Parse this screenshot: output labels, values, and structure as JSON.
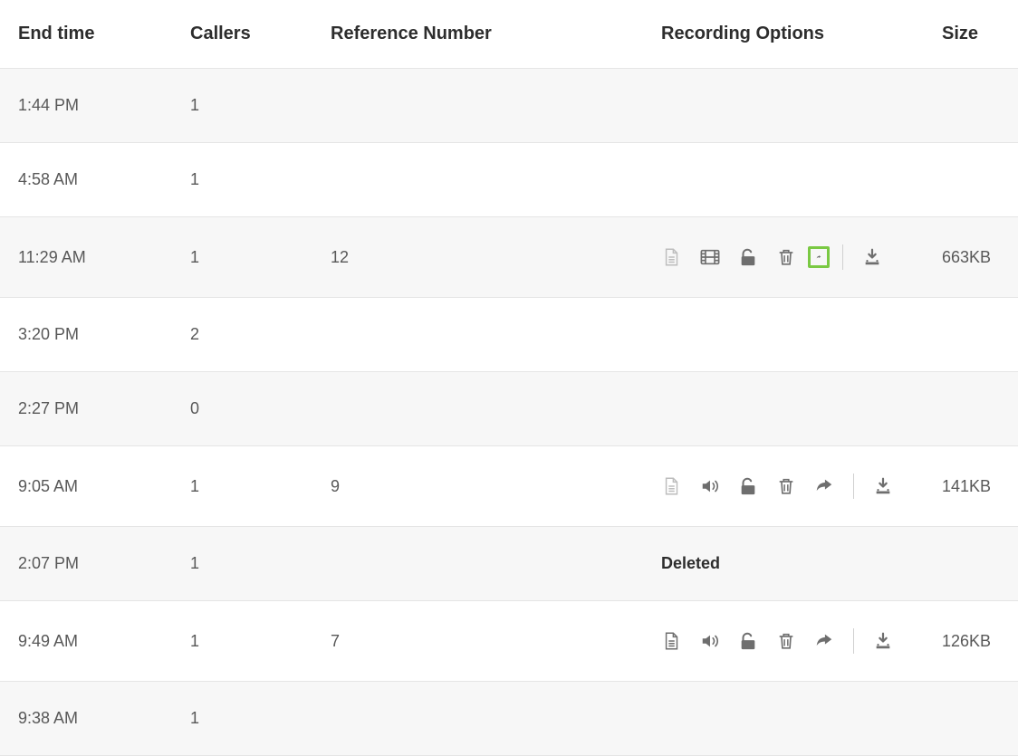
{
  "columns": {
    "end_time": "End time",
    "callers": "Callers",
    "reference": "Reference Number",
    "recording_options": "Recording Options",
    "size": "Size"
  },
  "labels": {
    "deleted": "Deleted"
  },
  "icon_colors": {
    "default": "#6e6e6e",
    "faded": "#bdbdbd",
    "highlight_border": "#7ac943"
  },
  "rows": [
    {
      "end_time": "1:44 PM",
      "callers": "1",
      "reference": "",
      "options": null,
      "size": ""
    },
    {
      "end_time": "4:58 AM",
      "callers": "1",
      "reference": "",
      "options": null,
      "size": ""
    },
    {
      "end_time": "11:29 AM",
      "callers": "1",
      "reference": "12",
      "options": {
        "type": "icons",
        "doc_faded": true,
        "second": "film",
        "highlight_share": true
      },
      "size": "663KB"
    },
    {
      "end_time": "3:20 PM",
      "callers": "2",
      "reference": "",
      "options": null,
      "size": ""
    },
    {
      "end_time": "2:27 PM",
      "callers": "0",
      "reference": "",
      "options": null,
      "size": ""
    },
    {
      "end_time": "9:05 AM",
      "callers": "1",
      "reference": "9",
      "options": {
        "type": "icons",
        "doc_faded": true,
        "second": "audio",
        "highlight_share": false
      },
      "size": "141KB"
    },
    {
      "end_time": "2:07 PM",
      "callers": "1",
      "reference": "",
      "options": {
        "type": "deleted"
      },
      "size": ""
    },
    {
      "end_time": "9:49 AM",
      "callers": "1",
      "reference": "7",
      "options": {
        "type": "icons",
        "doc_faded": false,
        "second": "audio",
        "highlight_share": false
      },
      "size": "126KB"
    },
    {
      "end_time": "9:38 AM",
      "callers": "1",
      "reference": "",
      "options": null,
      "size": ""
    }
  ]
}
